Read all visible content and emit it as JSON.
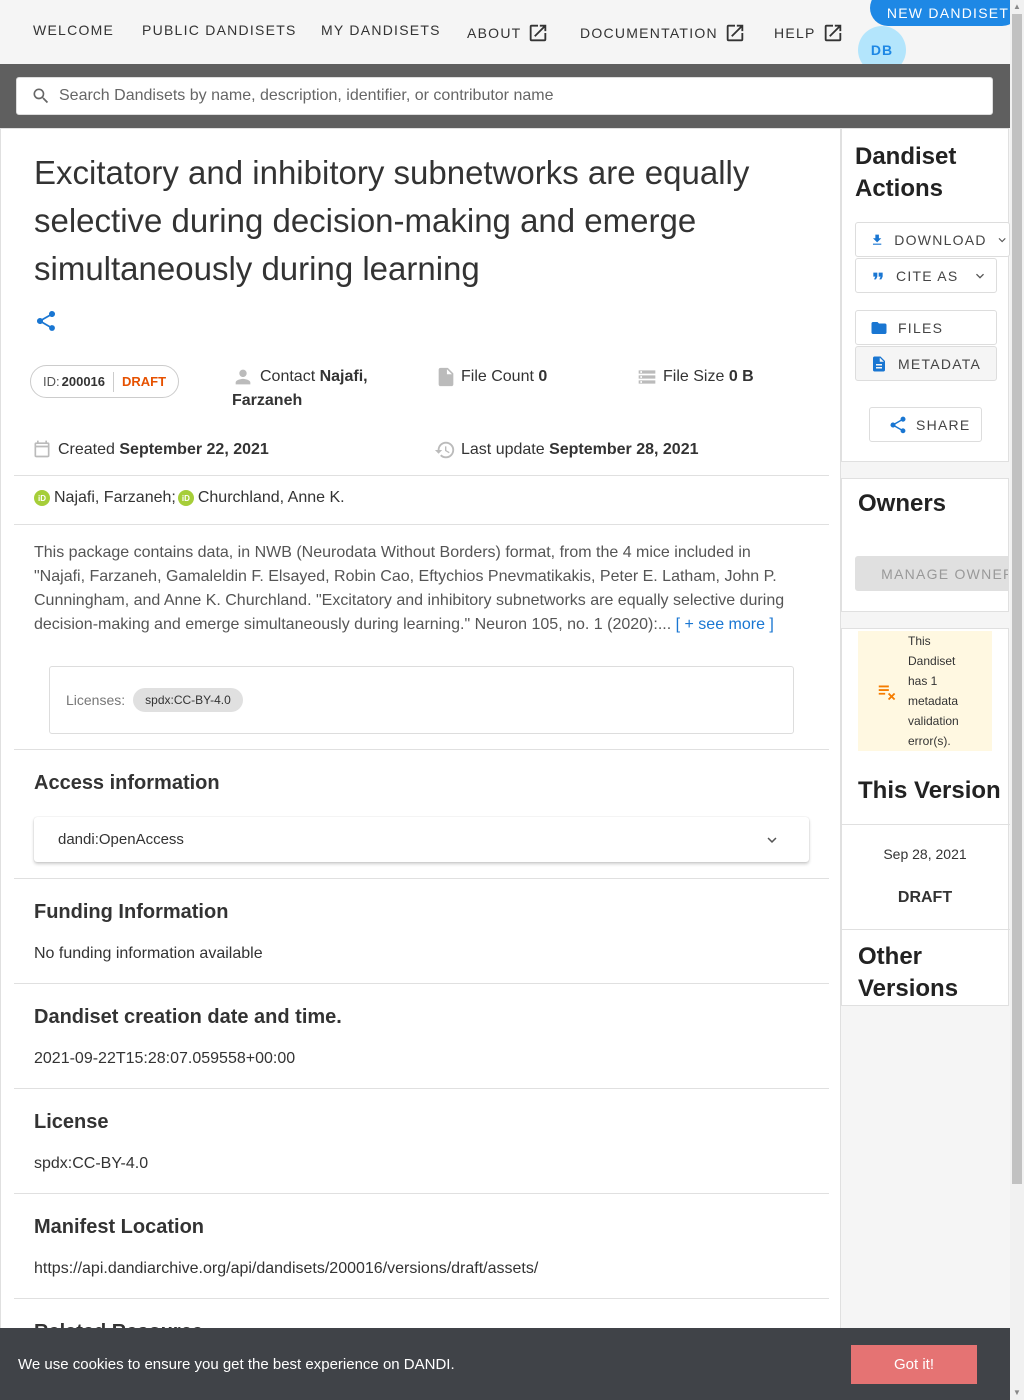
{
  "nav": {
    "welcome": "WELCOME",
    "public": "PUBLIC DANDISETS",
    "mine": "MY DANDISETS",
    "about": "ABOUT",
    "documentation": "DOCUMENTATION",
    "help": "HELP",
    "new_dandiset": "NEW DANDISET",
    "avatar": "DB"
  },
  "search": {
    "placeholder": "Search Dandisets by name, description, identifier, or contributor name"
  },
  "dandiset": {
    "title": "Excitatory and inhibitory subnetworks are equally selective during decision-making and emerge simultaneously during learning",
    "id_label": "ID:",
    "id": "200016",
    "status": "DRAFT",
    "contact_label": "Contact",
    "contact": "Najafi, Farzaneh",
    "file_count_label": "File Count",
    "file_count": "0",
    "file_size_label": "File Size",
    "file_size": "0 B",
    "created_label": "Created",
    "created": "September 22, 2021",
    "updated_label": "Last update",
    "updated": "September 28, 2021",
    "contributors": [
      "Najafi, Farzaneh;",
      "Churchland, Anne K."
    ],
    "description": "This package contains data, in NWB (Neurodata Without Borders) format, from the 4 mice included in \"Najafi, Farzaneh, Gamaleldin F. Elsayed, Robin Cao, Eftychios Pnevmatikakis, Peter E. Latham, John P. Cunningham, and Anne K. Churchland. \"Excitatory and inhibitory subnetworks are equally selective during decision-making and emerge simultaneously during learning.\" Neuron 105, no. 1 (2020):...",
    "see_more": "[ + see more ]",
    "licenses_label": "Licenses:",
    "license_chip": "spdx:CC-BY-4.0"
  },
  "sections": {
    "access_title": "Access information",
    "access_value": "dandi:OpenAccess",
    "funding_title": "Funding Information",
    "funding_value": "No funding information available",
    "creation_title": "Dandiset creation date and time.",
    "creation_value": "2021-09-22T15:28:07.059558+00:00",
    "license_title": "License",
    "license_value": "spdx:CC-BY-4.0",
    "manifest_title": "Manifest Location",
    "manifest_value": "https://api.dandiarchive.org/api/dandisets/200016/versions/draft/assets/",
    "related_title": "Related Resource"
  },
  "actions": {
    "title": "Dandiset Actions",
    "download": "DOWNLOAD",
    "cite": "CITE AS",
    "files": "FILES",
    "metadata": "METADATA",
    "share": "SHARE"
  },
  "owners": {
    "title": "Owners",
    "manage": "MANAGE OWNERS"
  },
  "validation": {
    "message": "This Dandiset has 1 metadata validation error(s)."
  },
  "version": {
    "title": "This Version",
    "date": "Sep 28, 2021",
    "status": "DRAFT",
    "other_title": "Other Versions"
  },
  "cookie": {
    "message": "We use cookies to ensure you get the best experience on DANDI.",
    "button": "Got it!"
  },
  "colors": {
    "accent": "#1976d2",
    "draft": "#e65100",
    "warning_bg": "#fff8e1",
    "cookie_bg": "#404348",
    "cookie_btn": "#e57373"
  }
}
